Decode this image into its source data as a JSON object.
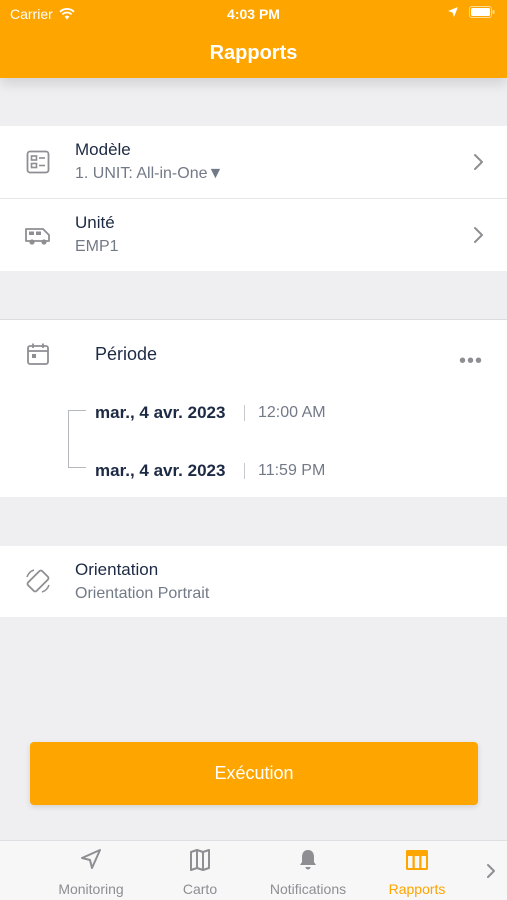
{
  "status_bar": {
    "carrier": "Carrier",
    "time": "4:03 PM"
  },
  "header": {
    "title": "Rapports"
  },
  "settings": {
    "model": {
      "label": "Modèle",
      "value": "1. UNIT: All-in-One▼",
      "icon": "template-icon"
    },
    "unit": {
      "label": "Unité",
      "value": "EMP1",
      "icon": "van-icon"
    }
  },
  "period": {
    "label": "Période",
    "icon": "calendar-icon",
    "start_date": "mar., 4 avr. 2023",
    "start_time": "12:00 AM",
    "end_date": "mar., 4 avr. 2023",
    "end_time": "11:59 PM"
  },
  "orientation": {
    "label": "Orientation",
    "value": "Orientation Portrait",
    "icon": "rotate-icon"
  },
  "execute_label": "Exécution",
  "tabs": [
    {
      "label": "Monitoring",
      "icon": "navigation-arrow-icon",
      "active": false
    },
    {
      "label": "Carto",
      "icon": "map-icon",
      "active": false
    },
    {
      "label": "Notifications",
      "icon": "bell-icon",
      "active": false
    },
    {
      "label": "Rapports",
      "icon": "table-icon",
      "active": true
    }
  ],
  "colors": {
    "accent": "#fea500",
    "background": "#efeff1",
    "text": "#1d2a44",
    "secondary_text": "#737a87",
    "icon": "#8e8e93"
  }
}
